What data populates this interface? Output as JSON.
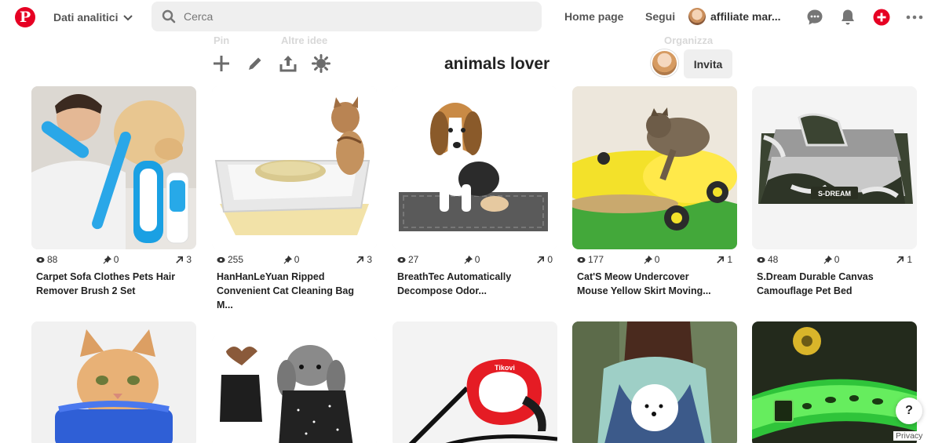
{
  "header": {
    "logo": "pinterest-logo",
    "logo_letter": "P",
    "analytics_label": "Dati analitici",
    "search_placeholder": "Cerca",
    "home_label": "Home page",
    "following_label": "Segui",
    "profile_name": "affiliate mar...",
    "brand_color": "#e60023"
  },
  "board": {
    "faded_tabs": [
      "Pin",
      "Altre idee",
      "Organizza"
    ],
    "title": "animals lover",
    "invite_label": "Invita",
    "tools": [
      "plus-icon",
      "pencil-icon",
      "share-icon",
      "settings-icon"
    ]
  },
  "pins": [
    {
      "views": "88",
      "saves": "0",
      "repins": "3",
      "title": "Carpet Sofa Clothes Pets Hair Remover Brush 2 Set",
      "title_l1": "Carpet Sofa Clothes Pets Hair",
      "title_l2": "Remover Brush 2 Set",
      "title_l3": ""
    },
    {
      "views": "255",
      "saves": "0",
      "repins": "3",
      "title": "HanHanLeYuan Ripped Convenient Cat Cleaning Bag M...",
      "title_l1": "HanHanLeYuan Ripped",
      "title_l2": "Convenient Cat Cleaning Bag",
      "title_l3": "M..."
    },
    {
      "views": "27",
      "saves": "0",
      "repins": "0",
      "title": "BreathTec Automatically Decompose Odor...",
      "title_l1": "BreathTec Automatically",
      "title_l2": "Decompose Odor...",
      "title_l3": ""
    },
    {
      "views": "177",
      "saves": "0",
      "repins": "1",
      "title": "Cat'S Meow Undercover Mouse Yellow Skirt Moving...",
      "title_l1": "Cat'S Meow Undercover",
      "title_l2": "Mouse Yellow Skirt Moving...",
      "title_l3": ""
    },
    {
      "views": "48",
      "saves": "0",
      "repins": "1",
      "title": "S.Dream Durable Canvas Camouflage Pet Bed",
      "title_l1": "S.Dream Durable Canvas",
      "title_l2": "Camouflage Pet Bed",
      "title_l3": ""
    }
  ],
  "image_text": {
    "bed_brand": "S-DREAM",
    "leash_brand": "Tikovi"
  },
  "help_label": "?",
  "privacy_label": "Privacy"
}
